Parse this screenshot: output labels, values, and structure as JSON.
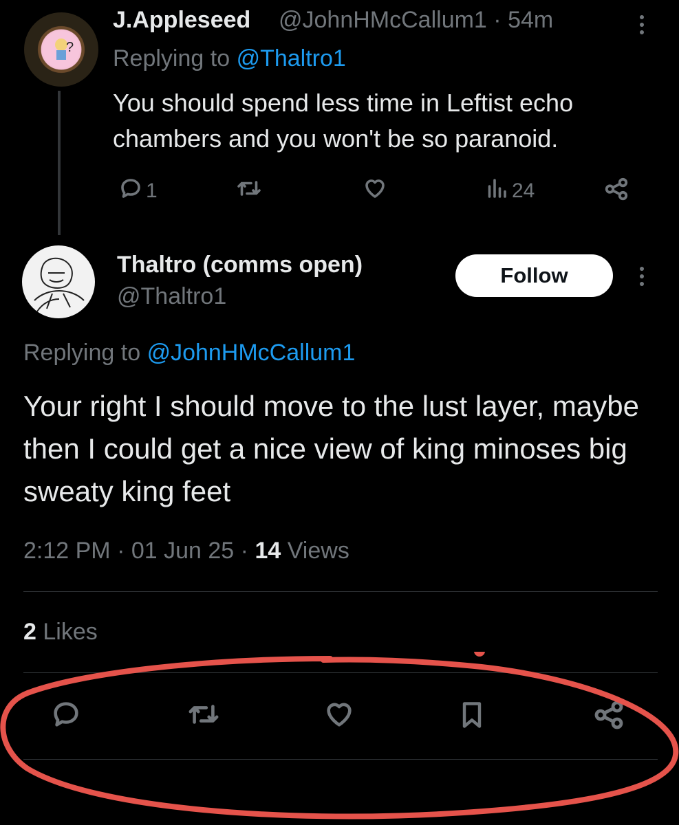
{
  "parent_tweet": {
    "display_name": "J.Appleseed",
    "handle": "@JohnHMcCallum1",
    "time": "· 54m",
    "replying_prefix": "Replying to",
    "replying_to": "@Thaltro1",
    "text": "You should spend less time in Leftist echo chambers and you won't be so paranoid.",
    "reply_count": "1",
    "views_count": "24"
  },
  "main_tweet": {
    "display_name": "Thaltro (comms open)",
    "handle": "@Thaltro1",
    "follow_label": "Follow",
    "replying_prefix": "Replying to",
    "replying_to": "@JohnHMcCallum1",
    "text": "Your right I should move to the lust layer, maybe then I could get a nice view of king minoses big sweaty king feet",
    "time": "2:12 PM",
    "date": "01 Jun 25",
    "views_count": "14",
    "views_label": "Views",
    "likes_count": "2",
    "likes_label": "Likes"
  },
  "icons": {
    "reply": "reply-icon",
    "retweet": "retweet-icon",
    "like": "heart-icon",
    "views": "views-chart-icon",
    "share": "share-icon",
    "bookmark": "bookmark-icon",
    "more": "more-options-icon"
  },
  "colors": {
    "background": "#000000",
    "text": "#e7e9ea",
    "muted": "#71767b",
    "link": "#1d9bf0",
    "highlight_circle": "#e5534b"
  }
}
